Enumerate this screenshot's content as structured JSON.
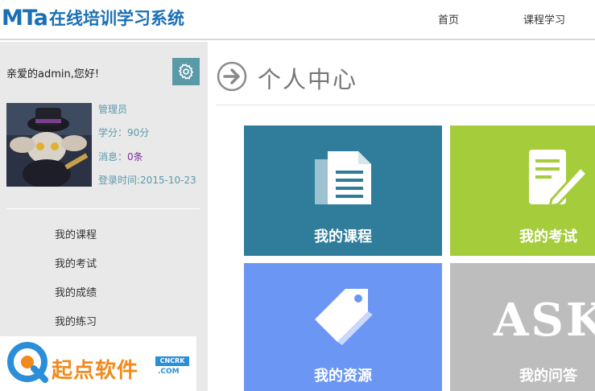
{
  "header": {
    "logo_brand": "MTa",
    "logo_text": "在线培训学习系统",
    "nav": [
      {
        "label": "首页"
      },
      {
        "label": "课程学习"
      }
    ]
  },
  "sidebar": {
    "greeting": "亲爱的admin,您好!",
    "role": "管理员",
    "score": "学分：90分",
    "message_label": "消息：",
    "message_count": "0条",
    "login_time": "登录时间:2015-10-23",
    "menu": [
      {
        "label": "我的课程"
      },
      {
        "label": "我的考试"
      },
      {
        "label": "我的成绩"
      },
      {
        "label": "我的练习"
      }
    ]
  },
  "main": {
    "title": "个人中心",
    "tiles": [
      {
        "label": "我的课程",
        "color": "#2f7d9b",
        "icon": "document-icon"
      },
      {
        "label": "我的考试",
        "color": "#a5cc3b",
        "icon": "exam-pen-icon"
      },
      {
        "label": "我的资源",
        "color": "#6b96f4",
        "icon": "tag-icon"
      },
      {
        "label": "我的问答",
        "color": "#bdbdbd",
        "icon": "ask-icon",
        "icon_text": "ASK"
      }
    ]
  },
  "watermark": {
    "text": "起点软件",
    "badge": "CNCRK",
    "sub": ".COM"
  },
  "colors": {
    "brand": "#1a6fb5",
    "sidebar_bg": "#e9e9e9",
    "info_text": "#5b9aab"
  }
}
